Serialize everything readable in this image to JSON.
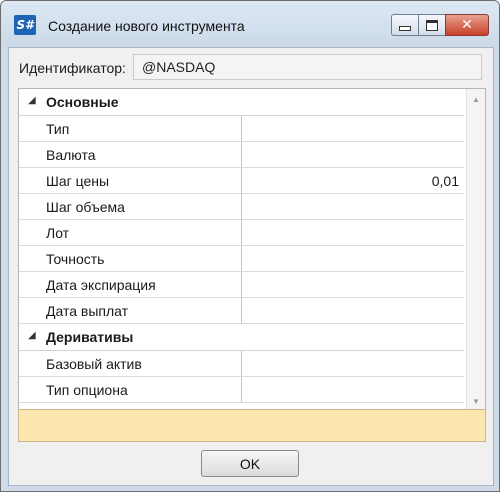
{
  "window": {
    "app_icon_text": "S#",
    "title": "Создание нового инструмента",
    "controls": [
      "minimize",
      "maximize",
      "close"
    ]
  },
  "identifier": {
    "label": "Идентификатор:",
    "value": "@NASDAQ"
  },
  "property_grid": {
    "groups": [
      {
        "label": "Основные",
        "properties": [
          {
            "name": "Тип",
            "value": ""
          },
          {
            "name": "Валюта",
            "value": ""
          },
          {
            "name": "Шаг цены",
            "value": "0,01"
          },
          {
            "name": "Шаг объема",
            "value": ""
          },
          {
            "name": "Лот",
            "value": ""
          },
          {
            "name": "Точность",
            "value": ""
          },
          {
            "name": "Дата экспирация",
            "value": ""
          },
          {
            "name": "Дата выплат",
            "value": ""
          }
        ]
      },
      {
        "label": "Деривативы",
        "properties": [
          {
            "name": "Базовый актив",
            "value": ""
          },
          {
            "name": "Тип опциона",
            "value": ""
          }
        ]
      }
    ]
  },
  "ok_button": {
    "label": "OK"
  }
}
